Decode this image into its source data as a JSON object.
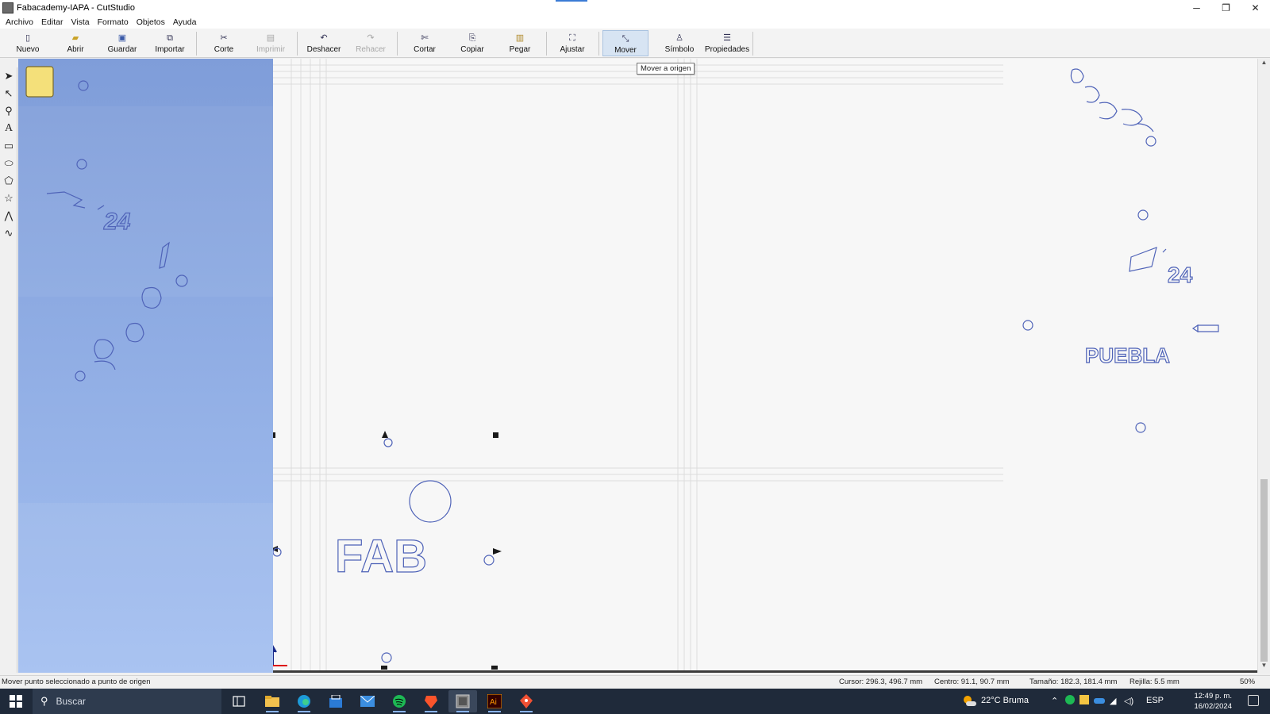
{
  "window": {
    "title": "Fabacademy-IAPA - CutStudio",
    "controls": {
      "minimize": "─",
      "restore": "❐",
      "close": "✕"
    }
  },
  "menu": [
    "Archivo",
    "Editar",
    "Vista",
    "Formato",
    "Objetos",
    "Ayuda"
  ],
  "toolbar": {
    "nuevo": "Nuevo",
    "abrir": "Abrir",
    "guardar": "Guardar",
    "importar": "Importar",
    "corte": "Corte",
    "imprimir": "Imprimir",
    "deshacer": "Deshacer",
    "rehacer": "Rehacer",
    "cortar": "Cortar",
    "copiar": "Copiar",
    "pegar": "Pegar",
    "ajustar": "Ajustar",
    "mover": "Mover",
    "simbolo": "Símbolo",
    "propiedades": "Propiedades"
  },
  "tooltip": "Mover a origen",
  "canvas": {
    "text_fab": "FAB",
    "text_24_left": "24",
    "text_24_right": "24",
    "text_puebla": "PUEBLA"
  },
  "status": {
    "message": "Mover punto seleccionado a punto de origen",
    "cursor": "Cursor: 296.3, 496.7 mm",
    "centro": "Centro: 91.1, 90.7 mm",
    "tamano": "Tamaño: 182.3, 181.4 mm",
    "rejilla": "Rejilla: 5.5 mm",
    "zoom": "50%"
  },
  "taskbar": {
    "search_placeholder": "Buscar",
    "weather": "22°C  Bruma",
    "lang": "ESP",
    "time": "12:49 p. m.",
    "date": "16/02/2024"
  },
  "colors": {
    "workspace_top": "#7f9dd9",
    "workspace_bottom": "#a3bff0",
    "taskbar": "#1f2a3a",
    "accent": "#3a7bd5"
  }
}
